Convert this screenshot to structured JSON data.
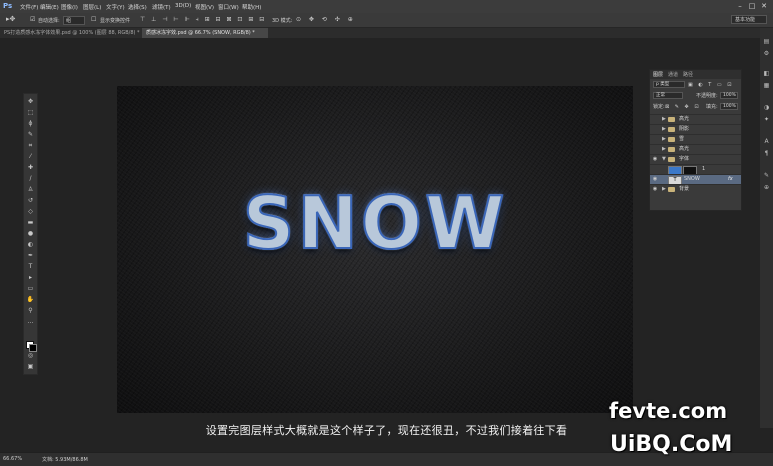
{
  "app": {
    "logo": "Ps"
  },
  "menubar": {
    "items": [
      "文件(F)",
      "编辑(E)",
      "图像(I)",
      "图层(L)",
      "文字(Y)",
      "选择(S)",
      "滤镜(T)",
      "3D(D)",
      "视图(V)",
      "窗口(W)",
      "帮助(H)"
    ]
  },
  "options_bar": {
    "auto_select_label": "自动选择:",
    "auto_select_value": "组",
    "show_transform_label": "显示变换控件",
    "mode_3d_label": "3D 模式:",
    "workspace_value": "基本功能"
  },
  "document_tabs": [
    {
      "label": "PS打造质感水冻字体效果.psd @ 100% (图层 88, RGB/8) *",
      "active": false
    },
    {
      "label": "质感冰冻字效.psd @ 66.7% (SNOW, RGB/8) *",
      "active": true
    }
  ],
  "canvas": {
    "headline": "SNOW"
  },
  "subtitle": "设置完图层样式大概就是这个样子了，现在还很丑，不过我们接着往下看",
  "layers_panel": {
    "tabs": [
      "图层",
      "通道",
      "路径"
    ],
    "filter_label": "p 类型",
    "blend_mode": "正常",
    "opacity_label": "不透明度:",
    "opacity_value": "100%",
    "lock_label": "锁定:",
    "fill_label": "填充:",
    "fill_value": "100%",
    "layers": [
      {
        "name": "高光",
        "type": "group",
        "visible": false,
        "expanded": false
      },
      {
        "name": "阴影",
        "type": "group",
        "visible": false,
        "expanded": false
      },
      {
        "name": "雪",
        "type": "group",
        "visible": false,
        "expanded": false
      },
      {
        "name": "高光",
        "type": "group",
        "visible": false,
        "expanded": false
      },
      {
        "name": "字体",
        "type": "group",
        "visible": true,
        "expanded": true
      },
      {
        "name": "1",
        "type": "layer",
        "visible": false,
        "expanded": false
      },
      {
        "name": "SNOW",
        "type": "text",
        "visible": true,
        "selected": true,
        "fx": "fx"
      },
      {
        "name": "背景",
        "type": "group",
        "visible": true,
        "expanded": false
      }
    ]
  },
  "status_bar": {
    "zoom": "66.67%",
    "doc_info": "文档: 5.93M/86.8M"
  },
  "watermark": {
    "line1": "fevte.com",
    "line2": "UiBQ.CoM"
  }
}
